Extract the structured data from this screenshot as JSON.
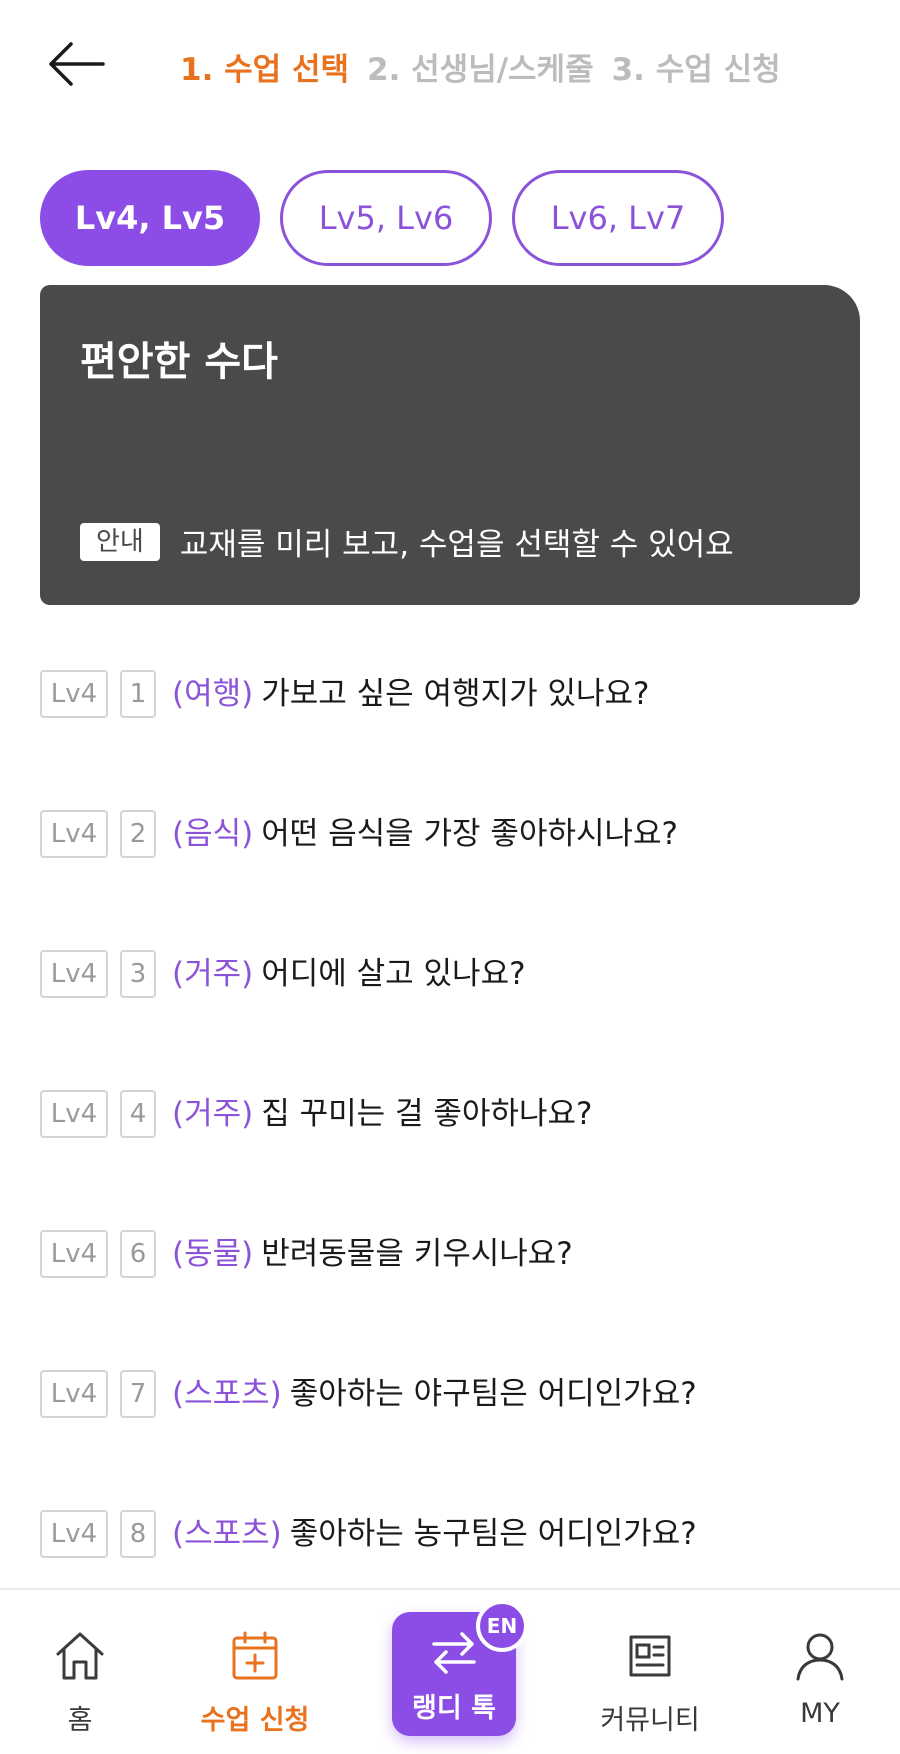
{
  "header": {
    "steps": [
      {
        "label": "1. 수업 선택",
        "active": true
      },
      {
        "label": "2. 선생님/스케줄",
        "active": false
      },
      {
        "label": "3. 수업 신청",
        "active": false
      }
    ]
  },
  "levels": [
    {
      "label": "Lv4, Lv5",
      "selected": true
    },
    {
      "label": "Lv5, Lv6",
      "selected": false
    },
    {
      "label": "Lv6, Lv7",
      "selected": false
    }
  ],
  "card": {
    "title": "편안한 수다",
    "info_badge": "안내",
    "info_text": "교재를 미리 보고, 수업을 선택할 수 있어요"
  },
  "lessons": [
    {
      "level": "Lv4",
      "number": "1",
      "category": "(여행)",
      "question": "가보고 싶은 여행지가 있나요?"
    },
    {
      "level": "Lv4",
      "number": "2",
      "category": "(음식)",
      "question": "어떤 음식을 가장 좋아하시나요?"
    },
    {
      "level": "Lv4",
      "number": "3",
      "category": "(거주)",
      "question": "어디에 살고 있나요?"
    },
    {
      "level": "Lv4",
      "number": "4",
      "category": "(거주)",
      "question": "집 꾸미는 걸 좋아하나요?"
    },
    {
      "level": "Lv4",
      "number": "6",
      "category": "(동물)",
      "question": "반려동물을 키우시나요?"
    },
    {
      "level": "Lv4",
      "number": "7",
      "category": "(스포츠)",
      "question": "좋아하는 야구팀은 어디인가요?"
    },
    {
      "level": "Lv4",
      "number": "8",
      "category": "(스포츠)",
      "question": "좋아하는 농구팀은 어디인가요?"
    }
  ],
  "nav": {
    "home": {
      "label": "홈",
      "icon": "home-icon"
    },
    "apply": {
      "label": "수업 신청",
      "icon": "calendar-plus-icon"
    },
    "talk": {
      "label": "랭디 톡",
      "badge": "EN",
      "icon": "swap-arrows-icon"
    },
    "community": {
      "label": "커뮤니티",
      "icon": "newspaper-icon"
    },
    "my": {
      "label": "MY",
      "icon": "user-icon"
    }
  },
  "colors": {
    "accent_orange": "#e9721e",
    "accent_purple": "#8b4de6",
    "card_bg": "#4a4a4a"
  }
}
